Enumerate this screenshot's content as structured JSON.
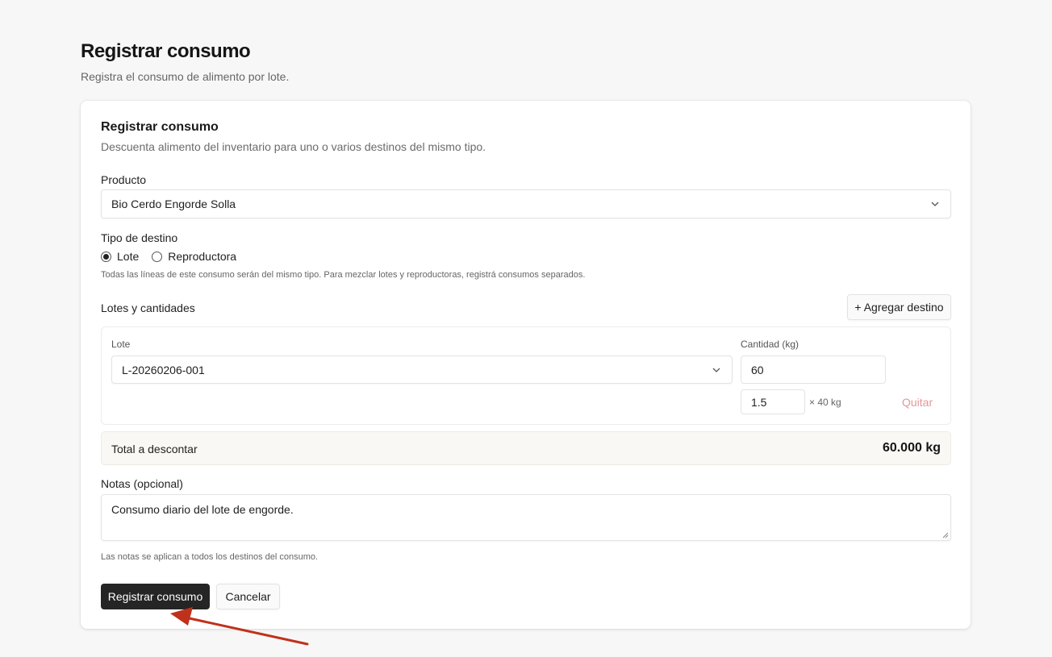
{
  "page": {
    "title": "Registrar consumo",
    "subtitle": "Registra el consumo de alimento por lote."
  },
  "card": {
    "title": "Registrar consumo",
    "description": "Descuenta alimento del inventario para uno o varios destinos del mismo tipo."
  },
  "product": {
    "label": "Producto",
    "selected": "Bio Cerdo Engorde Solla"
  },
  "destination_type": {
    "label": "Tipo de destino",
    "options": [
      {
        "label": "Lote",
        "checked": true
      },
      {
        "label": "Reproductora",
        "checked": false
      }
    ],
    "hint": "Todas las líneas de este consumo serán del mismo tipo. Para mezclar lotes y reproductoras, registrá consumos separados."
  },
  "lines": {
    "section_label": "Lotes y cantidades",
    "add_button": "+ Agregar destino",
    "items": [
      {
        "lot_label": "Lote",
        "lot_selected": "L-20260206-001",
        "qty_label": "Cantidad (kg)",
        "qty_value": "60",
        "units_value": "1.5",
        "unit_note": "× 40 kg",
        "remove_label": "Quitar"
      }
    ]
  },
  "total": {
    "label": "Total a descontar",
    "value": "60.000 kg"
  },
  "notes": {
    "label": "Notas (opcional)",
    "value": "Consumo diario del lote de engorde.",
    "hint": "Las notas se aplican a todos los destinos del consumo."
  },
  "actions": {
    "submit": "Registrar consumo",
    "cancel": "Cancelar"
  },
  "colors": {
    "primary_button": "#252525",
    "remove_link": "#e39898",
    "annotation_arrow": "#c0311b",
    "page_background": "#f7f7f7"
  }
}
